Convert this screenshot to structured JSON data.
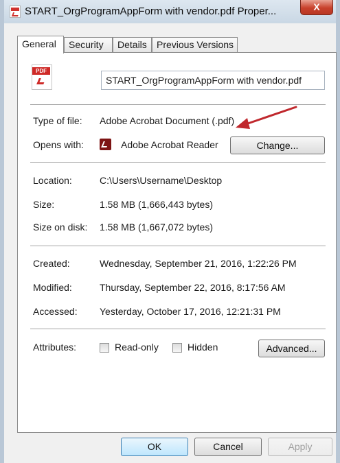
{
  "window": {
    "title": "START_OrgProgramAppForm with vendor.pdf Proper...",
    "close_label": "X"
  },
  "tabs": [
    {
      "label": "General",
      "active": true
    },
    {
      "label": "Security",
      "active": false
    },
    {
      "label": "Details",
      "active": false
    },
    {
      "label": "Previous Versions",
      "active": false
    }
  ],
  "file": {
    "icon_text": "PDF",
    "name": "START_OrgProgramAppForm with vendor.pdf"
  },
  "type_info": {
    "type_label": "Type of file:",
    "type_value": "Adobe Acrobat Document (.pdf)",
    "opens_label": "Opens with:",
    "opens_value": "Adobe Acrobat Reader",
    "change_button": "Change..."
  },
  "location_info": {
    "location_label": "Location:",
    "location_value": "C:\\Users\\Username\\Desktop",
    "size_label": "Size:",
    "size_value": "1.58 MB (1,666,443 bytes)",
    "size_on_disk_label": "Size on disk:",
    "size_on_disk_value": "1.58 MB (1,667,072 bytes)"
  },
  "dates": {
    "created_label": "Created:",
    "created_value": "Wednesday, September 21, 2016, 1:22:26 PM",
    "modified_label": "Modified:",
    "modified_value": "Thursday, September 22, 2016, 8:17:56 AM",
    "accessed_label": "Accessed:",
    "accessed_value": "Yesterday, October 17, 2016, 12:21:31 PM"
  },
  "attributes": {
    "label": "Attributes:",
    "readonly_label": "Read-only",
    "readonly_checked": false,
    "hidden_label": "Hidden",
    "hidden_checked": false,
    "advanced_button": "Advanced..."
  },
  "footer": {
    "ok_button": "OK",
    "cancel_button": "Cancel",
    "apply_button": "Apply"
  },
  "colors": {
    "annotation_arrow": "#c0282d",
    "pdf_red": "#cf2a27"
  },
  "icons": {
    "title": "pdf-file-icon",
    "file": "pdf-file-icon",
    "app": "acrobat-reader-icon",
    "annotation": "red-arrow-annotation"
  }
}
